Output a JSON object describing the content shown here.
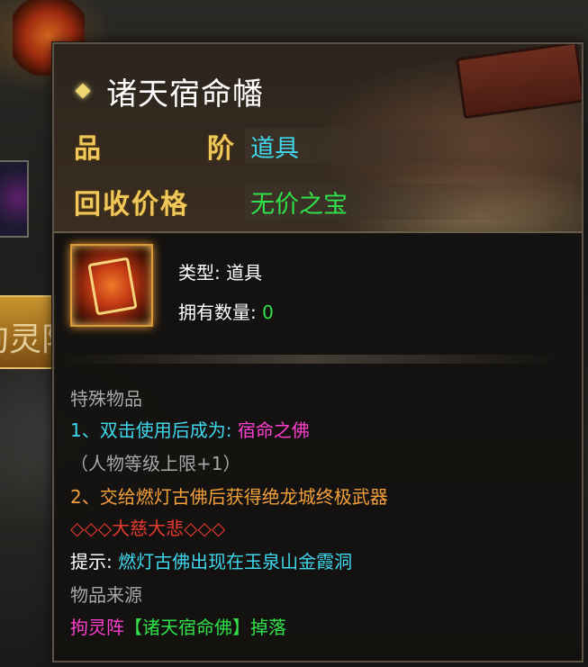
{
  "background": {
    "banner_text": "拘灵阵"
  },
  "item": {
    "name": "诸天宿命幡",
    "grade_label": "品阶",
    "grade_label_chars": [
      "品",
      "阶"
    ],
    "grade_value": "道具",
    "price_label": "回收价格",
    "price_value": "无价之宝",
    "type_label": "类型:",
    "type_value": "道具",
    "count_label": "拥有数量:",
    "count_value": "0",
    "icon": "scroll-banner-icon"
  },
  "description": {
    "category": "特殊物品",
    "line1_prefix": "1、双击使用后成为:",
    "line1_target": "宿命之佛",
    "line1_note": "（人物等级上限+1）",
    "line2": "2、交给燃灯古佛后获得绝龙城终极武器",
    "slogan": "◇◇◇大慈大悲◇◇◇",
    "hint_label": "提示:",
    "hint_text": "燃灯古佛出现在玉泉山金霞洞",
    "source_label": "物品来源",
    "source_place": "拘灵阵",
    "source_boss": "【诸天宿命佛】",
    "source_action": "掉落"
  },
  "colors": {
    "title": "#ffffff",
    "gold_label": "#f0c85a",
    "cyan": "#3fd8ee",
    "green": "#2fe24a",
    "magenta": "#ff3fd0",
    "gray": "#a8a8a8",
    "orange": "#f4a03a",
    "red": "#e83a2e"
  }
}
